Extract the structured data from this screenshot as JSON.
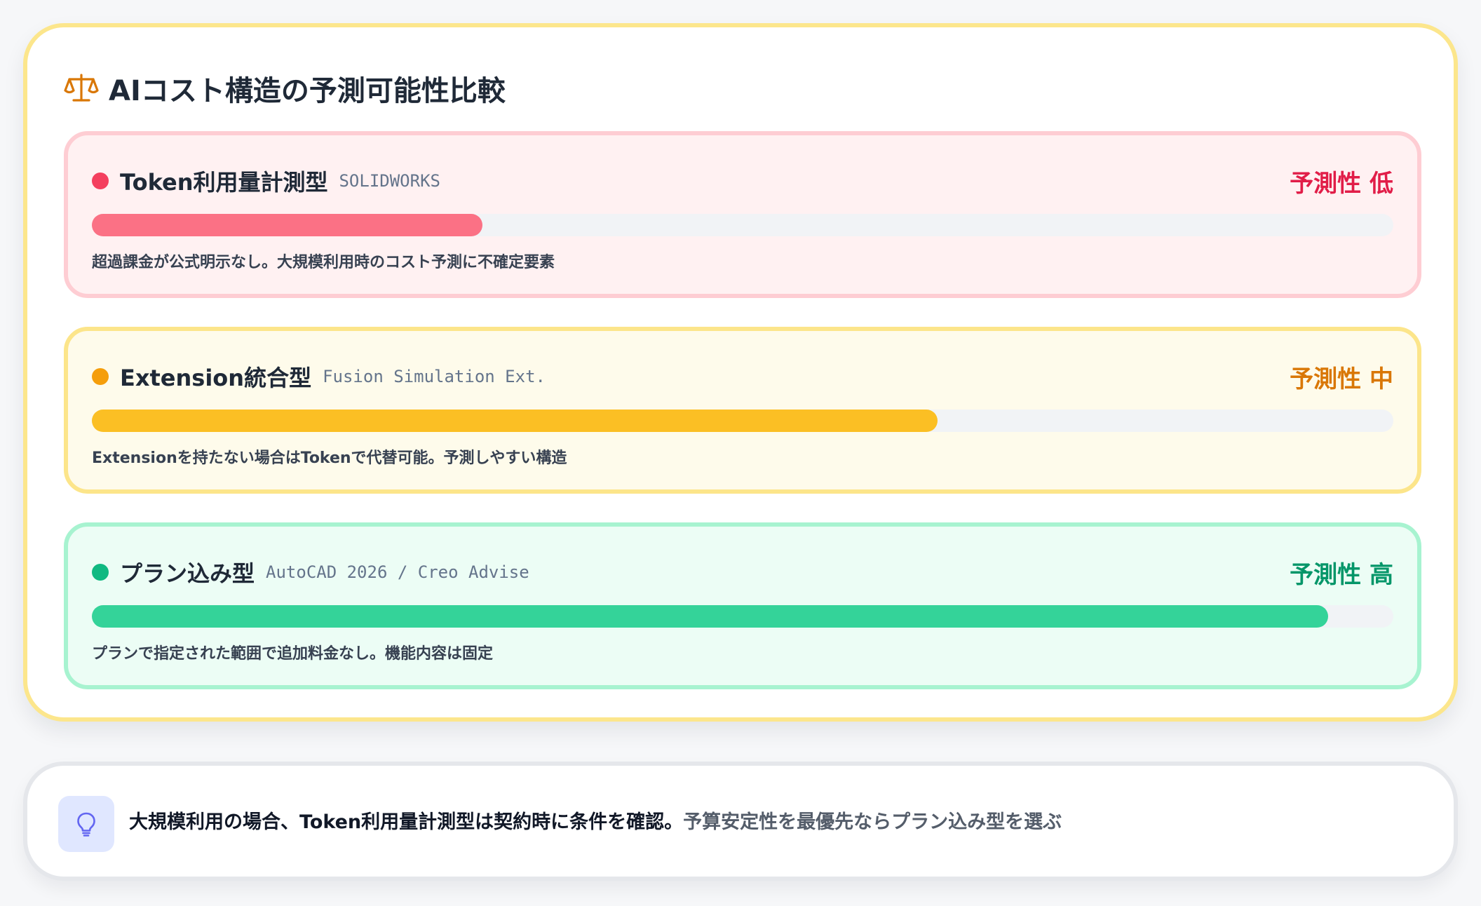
{
  "main": {
    "title": "AIコスト構造の予測可能性比較",
    "title_icon": "scale-icon",
    "items": [
      {
        "level": "low",
        "name": "Token利用量計測型",
        "product": "SOLIDWORKS",
        "rating": "予測性 低",
        "progress": 0.3,
        "description": "超過課金が公式明示なし。大規模利用時のコスト予測に不確定要素",
        "dot_color": "#f43f5e",
        "bar_color": "#fb7185",
        "rating_color": "#e11d48"
      },
      {
        "level": "mid",
        "name": "Extension統合型",
        "product": "Fusion Simulation Ext.",
        "rating": "予測性 中",
        "progress": 0.65,
        "description": "Extensionを持たない場合はTokenで代替可能。予測しやすい構造",
        "dot_color": "#f59e0b",
        "bar_color": "#fbbf24",
        "rating_color": "#d97706"
      },
      {
        "level": "high",
        "name": "プラン込み型",
        "product": "AutoCAD 2026 / Creo Advise",
        "rating": "予測性 高",
        "progress": 0.95,
        "description": "プランで指定された範囲で追加料金なし。機能内容は固定",
        "dot_color": "#10b981",
        "bar_color": "#34d399",
        "rating_color": "#059669"
      }
    ]
  },
  "tip": {
    "icon": "lightbulb-icon",
    "strong_text": "大規模利用の場合、Token利用量計測型は契約時に条件を確認。",
    "normal_text": "予算安定性を最優先ならプラン込み型を選ぶ"
  }
}
